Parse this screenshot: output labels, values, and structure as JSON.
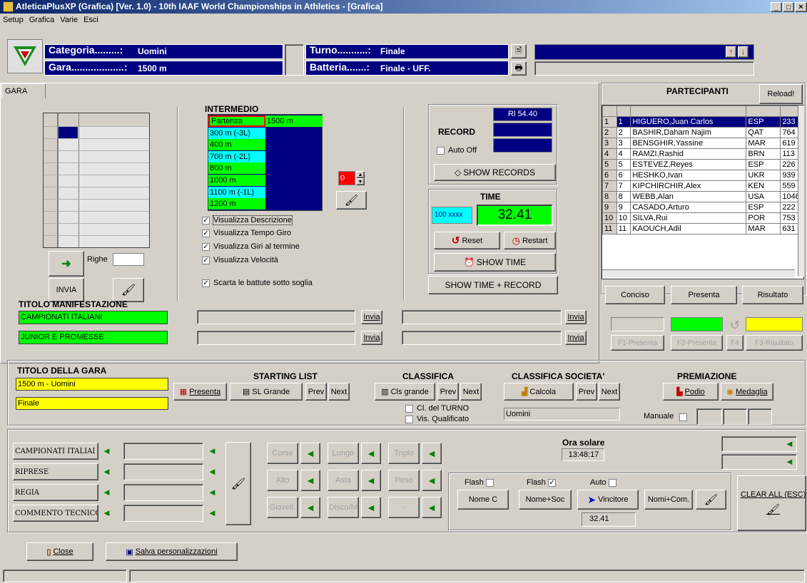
{
  "window": {
    "title": "AtleticaPlusXP (Grafica) [Ver. 1.0) - 10th IAAF World Championships in Athletics - [Grafica]"
  },
  "menu": [
    "Setup",
    "Grafica",
    "Varie",
    "Esci"
  ],
  "header": {
    "categoria_label": "Categoria.........:",
    "categoria_value": "Uomini",
    "gara_label": "Gara...................:",
    "gara_value": "1500 m",
    "turno_label": "Turno...........:",
    "turno_value": "Finale",
    "batteria_label": "Batteria.......:",
    "batteria_value": "Finale - UFF."
  },
  "tab": "GARA",
  "left": {
    "righe_label": "Righe",
    "invia": "INVIA"
  },
  "intermedio": {
    "title": "INTERMEDIO",
    "rows": [
      {
        "label": "Partenza",
        "value": "1500 m"
      },
      {
        "label": "300 m (-3L)",
        "value": ""
      },
      {
        "label": "400 m",
        "value": ""
      },
      {
        "label": "700 m (-2L)",
        "value": ""
      },
      {
        "label": "800 m",
        "value": ""
      },
      {
        "label": "1000 m",
        "value": ""
      },
      {
        "label": "1100 m (-1L)",
        "value": ""
      },
      {
        "label": "1200 m",
        "value": ""
      }
    ],
    "spin_value": "0",
    "checks": [
      {
        "label": "Visualizza Descrizione",
        "checked": true
      },
      {
        "label": "Visualizza Tempo Giro",
        "checked": true
      },
      {
        "label": "Visualizza Giri al termine",
        "checked": true
      },
      {
        "label": "Visualizza Velocità",
        "checked": true
      },
      {
        "label": "Scarta le battute sotto soglia",
        "checked": true
      }
    ]
  },
  "record": {
    "title": "RECORD",
    "rl": "Rl 54.40",
    "auto_off": "Auto Off",
    "show_records": "SHOW RECORDS"
  },
  "time": {
    "title": "TIME",
    "small": "100 xxxx",
    "value": "32.41",
    "reset": "Reset",
    "restart": "Restart",
    "show_time": "SHOW TIME",
    "show_time_record": "SHOW TIME + RECORD"
  },
  "partecipanti": {
    "title": "PARTECIPANTI",
    "reload": "Reload!",
    "rows": [
      [
        "1",
        "1",
        "HIGUERO,Juan Carlos",
        "ESP",
        "233"
      ],
      [
        "2",
        "2",
        "BASHIR,Daham Najim",
        "QAT",
        "764"
      ],
      [
        "3",
        "3",
        "BENSGHIR,Yassine",
        "MAR",
        "619"
      ],
      [
        "4",
        "4",
        "RAMZI,Rashid",
        "BRN",
        "113"
      ],
      [
        "5",
        "5",
        "ESTEVEZ,Reyes",
        "ESP",
        "226"
      ],
      [
        "6",
        "6",
        "HESHKO,Ivan",
        "UKR",
        "939"
      ],
      [
        "7",
        "7",
        "KIPCHIRCHIR,Alex",
        "KEN",
        "559"
      ],
      [
        "8",
        "8",
        "WEBB,Alan",
        "USA",
        "1046"
      ],
      [
        "9",
        "9",
        "CASADO,Arturo",
        "ESP",
        "222"
      ],
      [
        "10",
        "10",
        "SILVA,Rui",
        "POR",
        "753"
      ],
      [
        "11",
        "11",
        "KAOUCH,Adil",
        "MAR",
        "631"
      ]
    ],
    "conciso": "Conciso",
    "presenta": "Presenta",
    "risultato": "Risultato",
    "f1": "F1-Presenta",
    "f2": "F2-Presenta",
    "f4": "F4",
    "f3": "F3-Risultato"
  },
  "titolo_manifestazione": {
    "title": "TITOLO MANIFESTAZIONE",
    "line1": "CAMPIONATI ITALIANI",
    "line2": "JUNIOR E PROMESSE",
    "invia": "Invia"
  },
  "titolo_gara": {
    "title": "TITOLO DELLA GARA",
    "line1": "1500 m - Uomini",
    "line2": "Finale"
  },
  "starting_list": {
    "title": "STARTING LIST",
    "presenta": "Presenta",
    "sl_grande": "SL Grande",
    "prev": "Prev",
    "next": "Next"
  },
  "classifica": {
    "title": "CLASSIFICA",
    "cls_grande": "Cls grande",
    "prev": "Prev",
    "next": "Next",
    "cl_turno": "Cl. del TURNO",
    "vis_qual": "Vis. Qualificato"
  },
  "classifica_societa": {
    "title": "CLASSIFICA SOCIETA'",
    "calcola": "Calcola",
    "prev": "Prev",
    "next": "Next",
    "field": "Uomini"
  },
  "premiazione": {
    "title": "PREMIAZIONE",
    "podio": "Podio",
    "medaglia": "Medaglia",
    "manuale": "Manuale"
  },
  "bottom": {
    "left_btns": [
      "CAMPIONATI ITALIAI",
      "RIPRESE",
      "REGIA",
      "COMMENTO TECNICO"
    ],
    "events": [
      [
        "Corse",
        "Lungo",
        "Triplo"
      ],
      [
        "Alto",
        "Asta",
        "Peso"
      ],
      [
        "Giavell.",
        "Disco/M",
        "-"
      ]
    ],
    "ora_label": "Ora solare",
    "ora_value": "13:48:17",
    "flash1": "Flash",
    "flash2": "Flash",
    "auto": "Auto",
    "nome_c": "Nome C",
    "nome_soc": "Nome+Soc",
    "vincitore": "Vincitore",
    "vincitore_time": "32.41",
    "nomi_com": "Nomi+Com.",
    "clear_all": "CLEAR ALL (ESC)"
  },
  "footer": {
    "close": "Close",
    "salva": "Salva personalizzazioni"
  }
}
